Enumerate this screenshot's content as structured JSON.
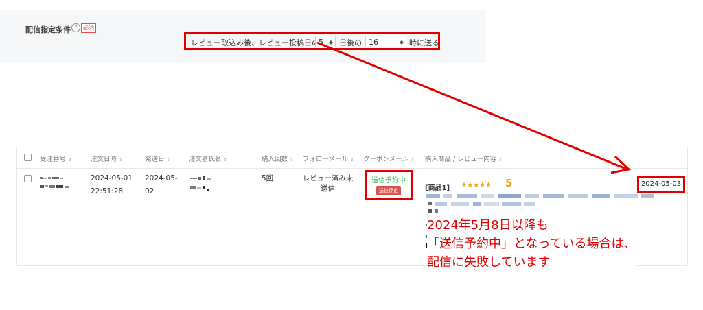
{
  "settings": {
    "condition_label": "配信指定条件",
    "help_icon_glyph": "?",
    "required_badge": "必須",
    "text_before": "レビュー取込み後、レビュー投稿日の",
    "days_value": "5",
    "text_days": "日後の",
    "hour_value": "16",
    "text_after": "時に送る"
  },
  "table": {
    "headers": [
      "受注番号",
      "注文日時",
      "発送日",
      "注文者氏名",
      "購入回数",
      "フォローメール",
      "クーポンメール",
      "購入商品 / レビュー内容"
    ],
    "row": {
      "order_date_line1": "2024-05-01",
      "order_date_line2": "22:51:28",
      "ship_date_line1": "2024-05-",
      "ship_date_line2": "02",
      "purchase_count": "5回",
      "follow_mail_line1": "レビュー済み未",
      "follow_mail_line2": "送信",
      "coupon_status": "送信予約中",
      "stop_button": "送信停止",
      "product_tag": "[商品1]",
      "stars": "★★★★★",
      "rating": "5",
      "review_date": "2024-05-03"
    }
  },
  "annotation": {
    "line1": "2024年5月8日以降も",
    "line2": "「送信予約中」となっている場合は、",
    "line3": "配信に失敗しています"
  },
  "colors": {
    "highlight": "#e10000",
    "status_green": "#2fb84c",
    "star": "#f4a21b"
  }
}
